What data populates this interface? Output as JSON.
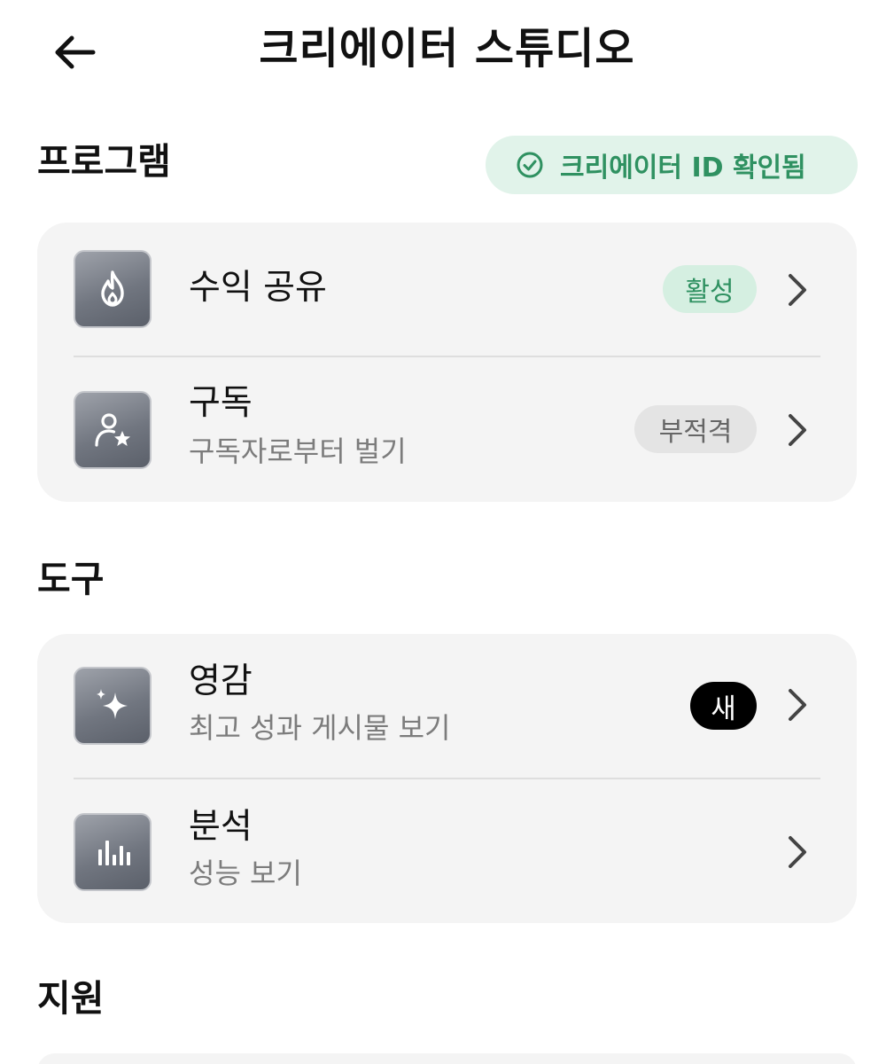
{
  "header": {
    "title": "크리에이터 스튜디오",
    "back_icon": "arrow-left-icon"
  },
  "sections": {
    "programs": {
      "title": "프로그램",
      "verified_badge": "크리에이터 ID 확인됨",
      "items": [
        {
          "icon": "flame-icon",
          "title": "수익 공유",
          "subtitle": "",
          "badge": "활성"
        },
        {
          "icon": "person-star-icon",
          "title": "구독",
          "subtitle": "구독자로부터 벌기",
          "badge": "부적격"
        }
      ]
    },
    "tools": {
      "title": "도구",
      "items": [
        {
          "icon": "sparkle-icon",
          "title": "영감",
          "subtitle": "최고 성과 게시물 보기",
          "badge": "새"
        },
        {
          "icon": "bar-chart-icon",
          "title": "분석",
          "subtitle": "성능 보기",
          "badge": ""
        }
      ]
    },
    "support": {
      "title": "지원"
    }
  },
  "colors": {
    "accent_green": "#2f9161",
    "active_badge_bg": "#d5efe1",
    "verified_badge_bg": "#e1f3ea",
    "card_bg": "#f4f4f4",
    "new_badge_bg": "#000000"
  }
}
